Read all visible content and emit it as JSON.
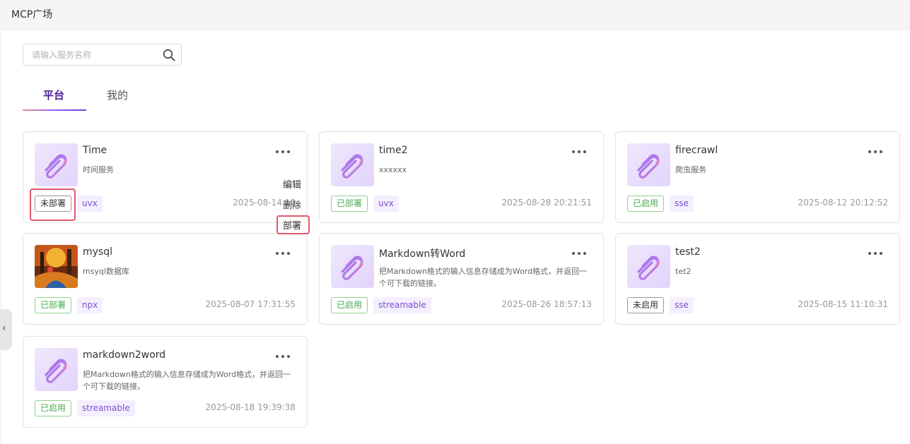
{
  "page": {
    "title": "MCP广场"
  },
  "search": {
    "placeholder": "请输入服务名称"
  },
  "tabs": [
    {
      "label": "平台",
      "active": true
    },
    {
      "label": "我的",
      "active": false
    }
  ],
  "colors": {
    "accent": "#6b3fd6",
    "active_tab_text": "#4b1d9a",
    "status_green": "#4ba94e",
    "type_tag_bg": "#f4effe",
    "highlight": "#e2586a"
  },
  "cards": [
    {
      "name": "Time",
      "desc": "时间服务",
      "status": "未部署",
      "status_style": "gray",
      "type": "uvx",
      "date": "2025-08-14 10",
      "logo": "paperclip-logo-icon"
    },
    {
      "name": "time2",
      "desc": "xxxxxx",
      "status": "已部署",
      "status_style": "green",
      "type": "uvx",
      "date": "2025-08-28 20:21:51",
      "logo": "paperclip-logo-icon"
    },
    {
      "name": "firecrawl",
      "desc": "爬虫服务",
      "status": "已启用",
      "status_style": "green",
      "type": "sse",
      "date": "2025-08-12 20:12:52",
      "logo": "paperclip-logo-icon"
    },
    {
      "name": "mysql",
      "desc": "msyql数据库",
      "status": "已部署",
      "status_style": "green",
      "type": "npx",
      "date": "2025-08-07 17:31:55",
      "logo": "painted-image-logo"
    },
    {
      "name": "Markdown转Word",
      "desc": "把Markdown格式的输入信息存储成为Word格式，并返回一个可下载的链接。",
      "status": "已启用",
      "status_style": "green",
      "type": "streamable",
      "date": "2025-08-26 18:57:13",
      "logo": "paperclip-logo-icon"
    },
    {
      "name": "test2",
      "desc": "tet2",
      "status": "未启用",
      "status_style": "gray",
      "type": "sse",
      "date": "2025-08-15 11:10:31",
      "logo": "paperclip-logo-icon"
    },
    {
      "name": "markdown2word",
      "desc": "把Markdown格式的输入信息存储成为Word格式，并返回一个可下载的链接。",
      "status": "已启用",
      "status_style": "green",
      "type": "streamable",
      "date": "2025-08-18 19:39:38",
      "logo": "paperclip-logo-icon"
    }
  ],
  "dropdown_menu": {
    "items": [
      "编辑",
      "删除",
      "部署"
    ]
  },
  "icons": {
    "search": "search-icon",
    "more": "more-dots-icon",
    "collapse": "chevron-left-icon"
  }
}
